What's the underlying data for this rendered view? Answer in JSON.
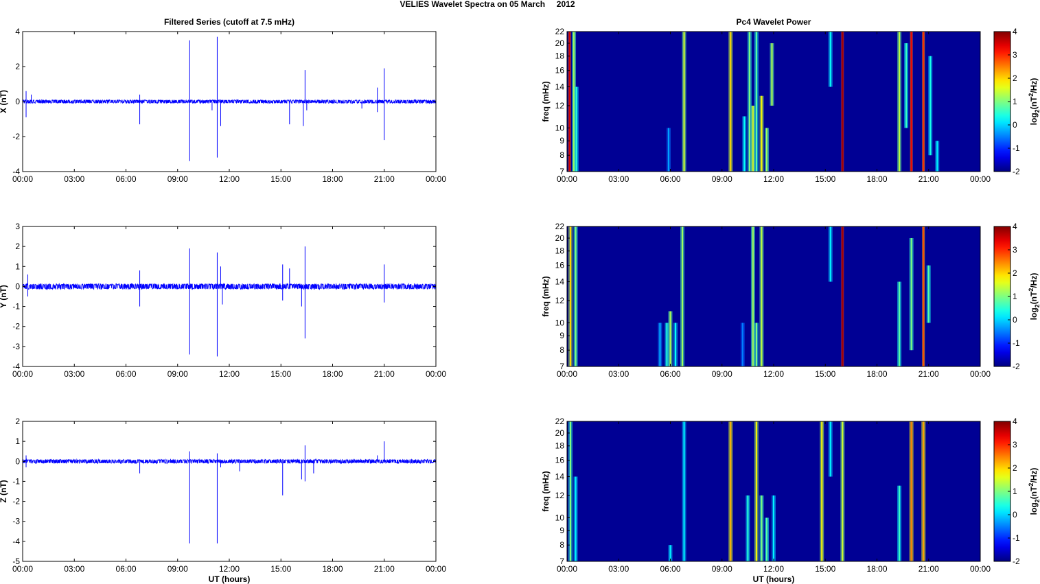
{
  "title": "VELIES Wavelet Spectra on 05 March     2012",
  "chart_data": [
    {
      "type": "line",
      "title": "Filtered Series (cutoff at 7.5 mHz)",
      "ylabel": "X (nT)",
      "xlabel": "",
      "ylim": [
        -4,
        4
      ],
      "yticks": [
        "-4",
        "-2",
        "0",
        "2",
        "4"
      ],
      "ytick_values": [
        -4,
        -2,
        0,
        2,
        4
      ],
      "xlim_hours": [
        0,
        24
      ],
      "xticks": [
        "00:00",
        "03:00",
        "06:00",
        "09:00",
        "12:00",
        "15:00",
        "18:00",
        "21:00",
        "00:00"
      ],
      "color": "#0000ff",
      "noise_amplitude": 0.07,
      "spikes": [
        [
          0.2,
          0.6
        ],
        [
          0.2,
          -0.9
        ],
        [
          0.5,
          0.4
        ],
        [
          6.8,
          -1.3
        ],
        [
          6.8,
          0.4
        ],
        [
          9.7,
          3.5
        ],
        [
          9.7,
          -3.4
        ],
        [
          11.3,
          3.7
        ],
        [
          11.3,
          -3.2
        ],
        [
          11.5,
          -1.4
        ],
        [
          11.0,
          -0.5
        ],
        [
          15.5,
          -1.3
        ],
        [
          16.3,
          -1.4
        ],
        [
          16.4,
          1.8
        ],
        [
          16.5,
          -0.5
        ],
        [
          19.7,
          -0.4
        ],
        [
          20.6,
          0.8
        ],
        [
          20.6,
          -0.6
        ],
        [
          21.0,
          1.9
        ],
        [
          21.0,
          -2.2
        ]
      ]
    },
    {
      "type": "line",
      "title": "",
      "ylabel": "Y (nT)",
      "xlabel": "",
      "ylim": [
        -4,
        3
      ],
      "yticks": [
        "-4",
        "-3",
        "-2",
        "-1",
        "0",
        "1",
        "2",
        "3"
      ],
      "ytick_values": [
        -4,
        -3,
        -2,
        -1,
        0,
        1,
        2,
        3
      ],
      "xlim_hours": [
        0,
        24
      ],
      "xticks": [
        "00:00",
        "03:00",
        "06:00",
        "09:00",
        "12:00",
        "15:00",
        "18:00",
        "21:00",
        "00:00"
      ],
      "color": "#0000ff",
      "noise_amplitude": 0.1,
      "spikes": [
        [
          0.3,
          0.6
        ],
        [
          0.3,
          -0.5
        ],
        [
          6.8,
          0.8
        ],
        [
          6.8,
          -1.0
        ],
        [
          9.7,
          1.9
        ],
        [
          9.7,
          -3.4
        ],
        [
          11.3,
          1.7
        ],
        [
          11.3,
          -3.5
        ],
        [
          11.5,
          1.0
        ],
        [
          11.6,
          -0.9
        ],
        [
          15.1,
          1.1
        ],
        [
          15.1,
          -0.7
        ],
        [
          15.5,
          0.9
        ],
        [
          16.2,
          -1.0
        ],
        [
          16.4,
          2.0
        ],
        [
          16.4,
          -2.6
        ],
        [
          21.0,
          1.1
        ],
        [
          21.0,
          -0.8
        ]
      ]
    },
    {
      "type": "line",
      "title": "",
      "ylabel": "Z (nT)",
      "xlabel": "UT (hours)",
      "ylim": [
        -5,
        2
      ],
      "yticks": [
        "-5",
        "-4",
        "-3",
        "-2",
        "-1",
        "0",
        "1",
        "2"
      ],
      "ytick_values": [
        -5,
        -4,
        -3,
        -2,
        -1,
        0,
        1,
        2
      ],
      "xlim_hours": [
        0,
        24
      ],
      "xticks": [
        "00:00",
        "03:00",
        "06:00",
        "09:00",
        "12:00",
        "15:00",
        "18:00",
        "21:00",
        "00:00"
      ],
      "color": "#0000ff",
      "noise_amplitude": 0.07,
      "spikes": [
        [
          0.2,
          0.3
        ],
        [
          0.2,
          -0.3
        ],
        [
          6.8,
          -0.6
        ],
        [
          9.7,
          0.5
        ],
        [
          9.7,
          -4.1
        ],
        [
          11.3,
          0.4
        ],
        [
          11.3,
          -4.1
        ],
        [
          11.5,
          -0.3
        ],
        [
          12.6,
          -0.5
        ],
        [
          15.1,
          -1.7
        ],
        [
          16.2,
          -0.9
        ],
        [
          16.4,
          0.8
        ],
        [
          16.4,
          -1.0
        ],
        [
          16.9,
          -0.6
        ],
        [
          20.6,
          0.3
        ],
        [
          21.0,
          1.0
        ]
      ]
    },
    {
      "type": "heatmap",
      "title": "Pc4 Wavelet Power",
      "ylabel": "freq (mHz)",
      "xlabel": "",
      "yscale": "log",
      "ylim": [
        7,
        22
      ],
      "yticks": [
        "7",
        "8",
        "9",
        "10",
        "12",
        "14",
        "16",
        "18",
        "20",
        "22"
      ],
      "ytick_values": [
        7,
        8,
        9,
        10,
        12,
        14,
        16,
        18,
        20,
        22
      ],
      "xticks": [
        "00:00",
        "03:00",
        "06:00",
        "09:00",
        "12:00",
        "15:00",
        "18:00",
        "21:00",
        "00:00"
      ],
      "colorbar": {
        "label_base": "log",
        "label_sub": "2",
        "label_mid": "(nT",
        "label_sup": "2",
        "label_end": "/Hz)",
        "range": [
          -2,
          4
        ],
        "ticks": [
          "-2",
          "-1",
          "0",
          "1",
          "2",
          "3",
          "4"
        ]
      },
      "streaks": [
        [
          0.15,
          7,
          22,
          3.5
        ],
        [
          0.4,
          7,
          22,
          1.2
        ],
        [
          0.55,
          7,
          14,
          0.5
        ],
        [
          5.9,
          7,
          10,
          -0.3
        ],
        [
          6.8,
          7,
          22,
          1.5
        ],
        [
          9.5,
          7,
          22,
          2.0
        ],
        [
          10.3,
          7,
          11,
          0.3
        ],
        [
          10.6,
          7,
          22,
          1.0
        ],
        [
          10.8,
          7,
          12,
          1.5
        ],
        [
          11.0,
          7,
          22,
          0.8
        ],
        [
          11.3,
          7,
          13,
          1.8
        ],
        [
          11.6,
          7,
          10,
          1.2
        ],
        [
          11.9,
          12,
          20,
          1.3
        ],
        [
          15.3,
          14,
          22,
          0.3
        ],
        [
          16.0,
          7,
          22,
          3.8
        ],
        [
          19.3,
          7,
          22,
          1.4
        ],
        [
          19.7,
          10,
          20,
          0.6
        ],
        [
          20.0,
          7,
          22,
          3.3
        ],
        [
          20.7,
          7,
          22,
          3.0
        ],
        [
          21.1,
          8,
          18,
          0.4
        ],
        [
          21.5,
          7,
          9,
          0.2
        ]
      ]
    },
    {
      "type": "heatmap",
      "title": "",
      "ylabel": "freq (mHz)",
      "xlabel": "",
      "yscale": "log",
      "ylim": [
        7,
        22
      ],
      "yticks": [
        "7",
        "8",
        "9",
        "10",
        "12",
        "14",
        "16",
        "18",
        "20",
        "22"
      ],
      "ytick_values": [
        7,
        8,
        9,
        10,
        12,
        14,
        16,
        18,
        20,
        22
      ],
      "xticks": [
        "00:00",
        "03:00",
        "06:00",
        "09:00",
        "12:00",
        "15:00",
        "18:00",
        "21:00",
        "00:00"
      ],
      "colorbar": {
        "label_base": "log",
        "label_sub": "2",
        "label_mid": "(nT",
        "label_sup": "2",
        "label_end": "/Hz)",
        "range": [
          -2,
          4
        ],
        "ticks": [
          "-2",
          "-1",
          "0",
          "1",
          "2",
          "3",
          "4"
        ]
      },
      "streaks": [
        [
          0.2,
          7,
          22,
          2.0
        ],
        [
          0.5,
          7,
          22,
          1.0
        ],
        [
          5.4,
          7,
          10,
          -0.2
        ],
        [
          5.8,
          7,
          10,
          0.5
        ],
        [
          6.0,
          7,
          11,
          1.3
        ],
        [
          6.3,
          7,
          10,
          0.3
        ],
        [
          6.7,
          7,
          22,
          1.2
        ],
        [
          10.2,
          7,
          10,
          -0.5
        ],
        [
          10.8,
          7,
          22,
          1.2
        ],
        [
          11.0,
          7,
          10,
          1.0
        ],
        [
          11.3,
          7,
          22,
          1.4
        ],
        [
          15.3,
          14,
          22,
          0.2
        ],
        [
          16.0,
          7,
          22,
          3.8
        ],
        [
          19.3,
          7,
          14,
          0.8
        ],
        [
          20.0,
          8,
          20,
          1.0
        ],
        [
          20.7,
          7,
          22,
          2.8
        ],
        [
          21.0,
          10,
          16,
          0.8
        ]
      ]
    },
    {
      "type": "heatmap",
      "title": "",
      "ylabel": "freq (mHz)",
      "xlabel": "UT (hours)",
      "yscale": "log",
      "ylim": [
        7,
        22
      ],
      "yticks": [
        "7",
        "8",
        "9",
        "10",
        "12",
        "14",
        "16",
        "18",
        "20",
        "22"
      ],
      "ytick_values": [
        7,
        8,
        9,
        10,
        12,
        14,
        16,
        18,
        20,
        22
      ],
      "xticks": [
        "00:00",
        "03:00",
        "06:00",
        "09:00",
        "12:00",
        "15:00",
        "18:00",
        "21:00",
        "00:00"
      ],
      "colorbar": {
        "label_base": "log",
        "label_sub": "2",
        "label_mid": "(nT",
        "label_sup": "2",
        "label_end": "/Hz)",
        "range": [
          -2,
          4
        ],
        "ticks": [
          "-2",
          "-1",
          "0",
          "1",
          "2",
          "3",
          "4"
        ]
      },
      "streaks": [
        [
          0.2,
          7,
          22,
          1.0
        ],
        [
          0.5,
          7,
          14,
          0.2
        ],
        [
          6.0,
          7,
          8,
          0.2
        ],
        [
          6.8,
          7,
          22,
          0.2
        ],
        [
          9.5,
          7,
          22,
          2.2
        ],
        [
          10.5,
          7,
          12,
          0.5
        ],
        [
          11.0,
          7,
          22,
          1.8
        ],
        [
          11.3,
          7,
          12,
          1.0
        ],
        [
          11.6,
          7,
          10,
          0.8
        ],
        [
          12.0,
          7,
          12,
          0.2
        ],
        [
          14.8,
          7,
          22,
          1.8
        ],
        [
          15.3,
          14,
          22,
          0.2
        ],
        [
          16.0,
          7,
          22,
          1.5
        ],
        [
          19.3,
          7,
          13,
          0.6
        ],
        [
          20.0,
          7,
          22,
          2.5
        ],
        [
          20.7,
          7,
          22,
          2.3
        ]
      ]
    }
  ]
}
